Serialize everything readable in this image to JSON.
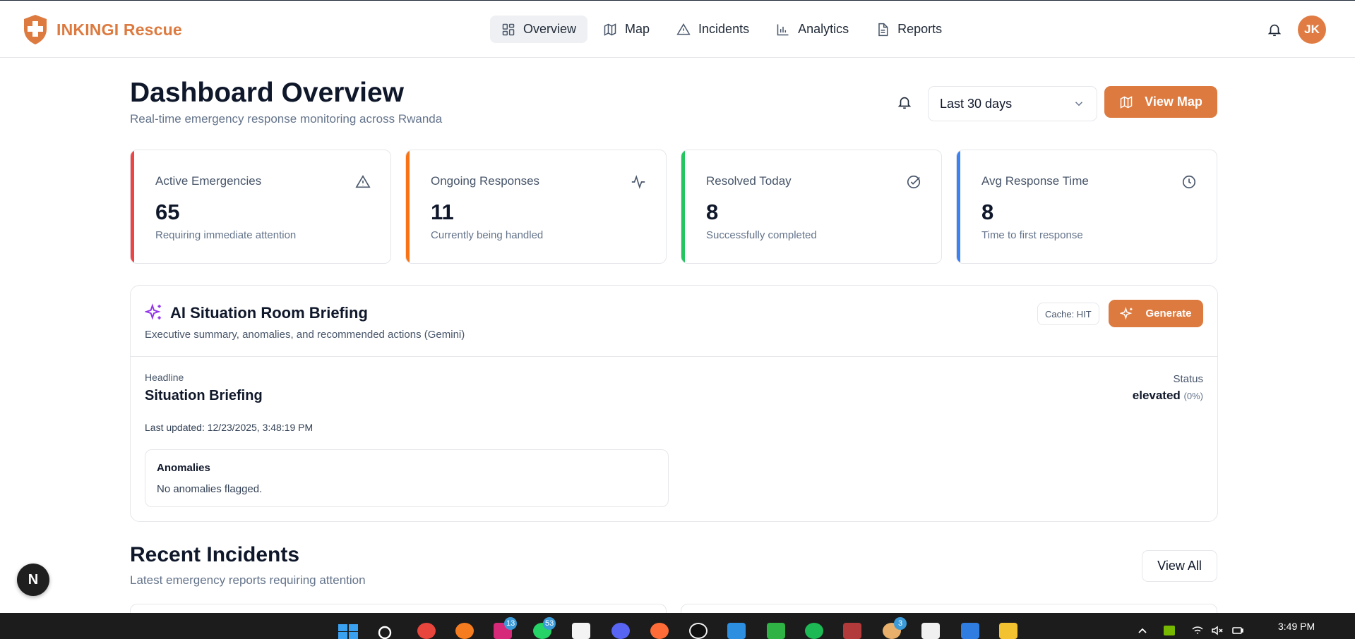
{
  "brand": {
    "name": "INKINGI Rescue",
    "color": "#dd7a3f"
  },
  "nav": {
    "items": [
      {
        "label": "Overview",
        "icon": "layout-grid-icon",
        "active": true
      },
      {
        "label": "Map",
        "icon": "map-icon"
      },
      {
        "label": "Incidents",
        "icon": "alert-triangle-icon"
      },
      {
        "label": "Analytics",
        "icon": "bar-chart-icon"
      },
      {
        "label": "Reports",
        "icon": "file-text-icon"
      }
    ],
    "avatar_initials": "JK"
  },
  "header": {
    "title": "Dashboard Overview",
    "subtitle": "Real-time emergency response monitoring across Rwanda",
    "date_range": "Last 30 days",
    "view_map_label": "View Map"
  },
  "stats": [
    {
      "label": "Active Emergencies",
      "value": "65",
      "desc": "Requiring immediate attention",
      "icon": "alert-triangle-icon",
      "color": "#ef4444"
    },
    {
      "label": "Ongoing Responses",
      "value": "11",
      "desc": "Currently being handled",
      "icon": "activity-icon",
      "color": "#f97316"
    },
    {
      "label": "Resolved Today",
      "value": "8",
      "desc": "Successfully completed",
      "icon": "check-circle-icon",
      "color": "#22c55e"
    },
    {
      "label": "Avg Response Time",
      "value": "8",
      "desc": "Time to first response",
      "icon": "clock-icon",
      "color": "#3b82f6"
    }
  ],
  "ai_briefing": {
    "title": "AI Situation Room Briefing",
    "subtitle": "Executive summary, anomalies, and recommended actions (Gemini)",
    "cache_badge": "Cache: HIT",
    "generate_label": "Generate",
    "headline_label": "Headline",
    "headline": "Situation Briefing",
    "status_label": "Status",
    "status": "elevated",
    "status_pct": "(0%)",
    "last_updated": "Last updated: 12/23/2025, 3:48:19 PM",
    "anomalies_title": "Anomalies",
    "anomalies_text": "No anomalies flagged."
  },
  "recent_incidents": {
    "title": "Recent Incidents",
    "subtitle": "Latest emergency reports requiring attention",
    "view_all_label": "View All"
  },
  "dev_badge": "N",
  "taskbar": {
    "badges": [
      "13",
      "53",
      "3"
    ],
    "time": "3:49 PM"
  }
}
